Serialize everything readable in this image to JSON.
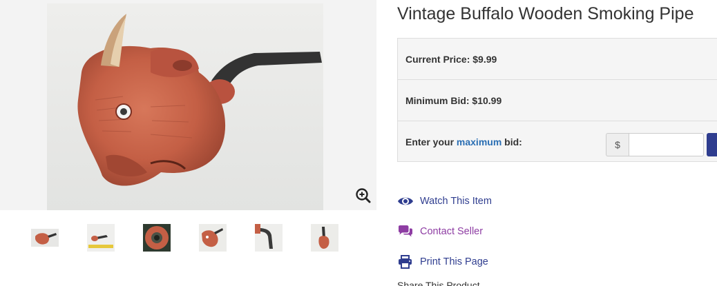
{
  "product": {
    "title": "Vintage Buffalo Wooden Smoking Pipe"
  },
  "gallery": {
    "main_image_icon": "buffalo-pipe-photo",
    "zoom_icon": "zoom-in-icon",
    "thumbnails": [
      {
        "icon": "thumbnail-buffalo-pipe-side"
      },
      {
        "icon": "thumbnail-pipe-with-ruler"
      },
      {
        "icon": "thumbnail-pipe-bowl-top"
      },
      {
        "icon": "thumbnail-buffalo-pipe-front"
      },
      {
        "icon": "thumbnail-pipe-stem"
      },
      {
        "icon": "thumbnail-pipe-upright"
      }
    ]
  },
  "bidding": {
    "current_price_label": "Current Price: $9.99",
    "minimum_bid_label": "Minimum Bid: $10.99",
    "enter_prefix": "Enter your ",
    "enter_link": "maximum",
    "enter_suffix": " bid:",
    "currency_symbol": "$",
    "bid_value": "",
    "bid_placeholder": ""
  },
  "actions": {
    "watch_label": "Watch This Item",
    "contact_label": "Contact Seller",
    "print_label": "Print This Page",
    "share_label": "Share This Product"
  },
  "colors": {
    "primary": "#2f3d8f",
    "contact": "#8e3da3",
    "link": "#2a6eb3"
  }
}
